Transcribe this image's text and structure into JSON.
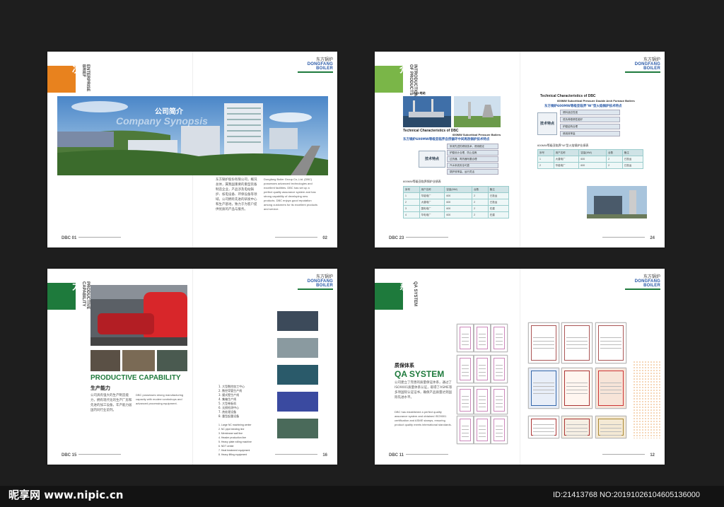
{
  "brand": {
    "logo_cn": "东方锅炉",
    "logo_en": "DONGFANG BOILER",
    "accent_orange": "#e8821e",
    "accent_green": "#7ab648",
    "accent_darkgreen": "#1e7a3c"
  },
  "spread1": {
    "section_cn": "企业概况",
    "section_en": "ENTERPRISE BRIEF",
    "banner_cn": "公司简介",
    "banner_en": "Company Synopsis",
    "body_cn": "东方锅炉股份有限公司，概况总体，属我国重要的重型装备制造企业，产品涉及电站锅炉、核电设备、环保设备等领域，公司拥有先进的研发中心和生产基地，致力于为客户提供优质的产品与服务。",
    "body_en": "Dongfang Boiler Group Co.,Ltd. (DBC) possesses advanced technologies and excellent facilities. DBC has set up a perfect quality assurance system and has strong capability of developing new products. DBC enjoys good reputation among customers for its excellent products and service.",
    "folio_left": "DBC 01",
    "folio_right": "02"
  },
  "spread2": {
    "section_cn": "产品简介",
    "section_en": "INTRODUCTION OF PRODUCTS",
    "photo_caption": "DBC电站",
    "left_heading_en": "Technical Characteristics of DBC",
    "left_sub_en": "600MW Subcritical Pressure Boilers",
    "left_heading_cn": "东方锅炉600MW等级亚临界自然循环中间再热锅炉技术特点",
    "feature_box": "技术特点",
    "left_features": [
      "采用先进的燃烧技术，燃烧稳定",
      "炉膛设计合理，防止结焦",
      "过热器、再热器布置合理",
      "汽水系统安全可靠",
      "锅炉效率高，运行灵活"
    ],
    "left_table_title": "600MW等级亚临界锅炉业绩表",
    "left_table": [
      [
        "序号",
        "用户名称",
        "容量(MW)",
        "台数",
        "备注"
      ],
      [
        "1",
        "华能电厂",
        "600",
        "2",
        "已投运"
      ],
      [
        "2",
        "大唐电厂",
        "600",
        "2",
        "已投运"
      ],
      [
        "3",
        "国电电厂",
        "600",
        "2",
        "在建"
      ],
      [
        "4",
        "华电电厂",
        "600",
        "2",
        "在建"
      ]
    ],
    "right_heading_en": "Technical Characteristics of DBC",
    "right_sub_en": "600MW Subcritical Pressure Double Arch Furnace Boilers",
    "right_heading_cn": "东方锅炉600MW等级亚临界\"W\"型火焰锅炉技术特点",
    "right_features": [
      "燃料适应性强",
      "低负荷稳燃性能好",
      "炉膛结构合理",
      "燃烧效率高"
    ],
    "right_table_title": "600MW等级亚临界\"W\"型火焰锅炉业绩表",
    "right_table": [
      [
        "序号",
        "用户名称",
        "容量(MW)",
        "台数",
        "备注"
      ],
      [
        "1",
        "大唐电厂",
        "600",
        "2",
        "已投运"
      ],
      [
        "2",
        "华能电厂",
        "600",
        "2",
        "已投运"
      ]
    ],
    "folio_left": "DBC 23",
    "folio_right": "24"
  },
  "spread3": {
    "section_cn": "生产能力",
    "section_en": "PRODUCTIVE CAPABILITY",
    "heading_en": "PRODUCTIVE CAPABILITY",
    "heading_cn": "生产能力",
    "body_cn": "公司具有强大的生产制造能力，拥有现代化的生产厂房和先进的加工设备，年产能力居国内同行业前列。",
    "body_en": "DBC possesses strong manufacturing capacity with modern workshops and advanced processing equipment.",
    "list_cn": [
      "大型数控加工中心",
      "数控弯管生产线",
      "膜式壁生产线",
      "集箱生产线",
      "大型卷板机",
      "无损检测中心",
      "热处理设备",
      "重型起重设备"
    ],
    "list_en": [
      "Large NC machining center",
      "NC pipe bending line",
      "Membrane wall line",
      "Header production line",
      "Heavy plate rolling machine",
      "NDT center",
      "Heat treatment equipment",
      "Heavy lifting equipment"
    ],
    "folio_left": "DBC 15",
    "folio_right": "16"
  },
  "spread4": {
    "section_cn": "质保体系",
    "section_en": "QA SYSTEM",
    "heading_cn": "质保体系",
    "heading_en": "QA SYSTEM",
    "body_cn": "公司建立了完善的质量保证体系，通过了ISO9001质量体系认证，取得了ASME等多项国际认证证书，确保产品质量达到国际先进水平。",
    "body_en": "DBC has established a perfect quality assurance system and obtained ISO9001 certification and ASME stamps, ensuring product quality meets international standards.",
    "cert_top_caption": "工程设计证书",
    "cert_bottom_caption": "证书",
    "folio_left": "DBC 11",
    "folio_right": "12"
  },
  "watermark": {
    "site": "昵享网 www.nipic.cn",
    "id": "ID:21413768 NO:20191026104605136000"
  }
}
